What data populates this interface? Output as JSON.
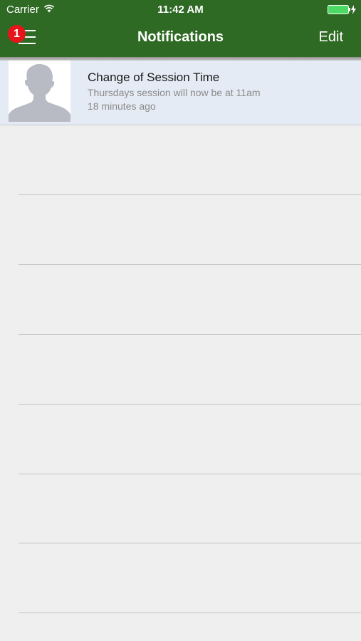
{
  "status_bar": {
    "carrier": "Carrier",
    "time": "11:42 AM",
    "wifi_icon": "wifi-icon",
    "battery_icon": "battery-charging-icon",
    "battery_color": "#4cd964"
  },
  "nav": {
    "title": "Notifications",
    "edit_label": "Edit",
    "menu_icon": "hamburger-menu-icon",
    "badge_count": "1",
    "bar_color": "#2f6a24",
    "badge_color": "#e8141b"
  },
  "notifications": [
    {
      "title": "Change of Session Time",
      "message": "Thursdays session will now be at 11am",
      "time": "18 minutes ago",
      "avatar_icon": "default-profile-silhouette-icon"
    }
  ],
  "theme": {
    "background": "#efefef",
    "row_highlight": "#e5ebf5",
    "secondary_text": "#8a8a8a"
  }
}
